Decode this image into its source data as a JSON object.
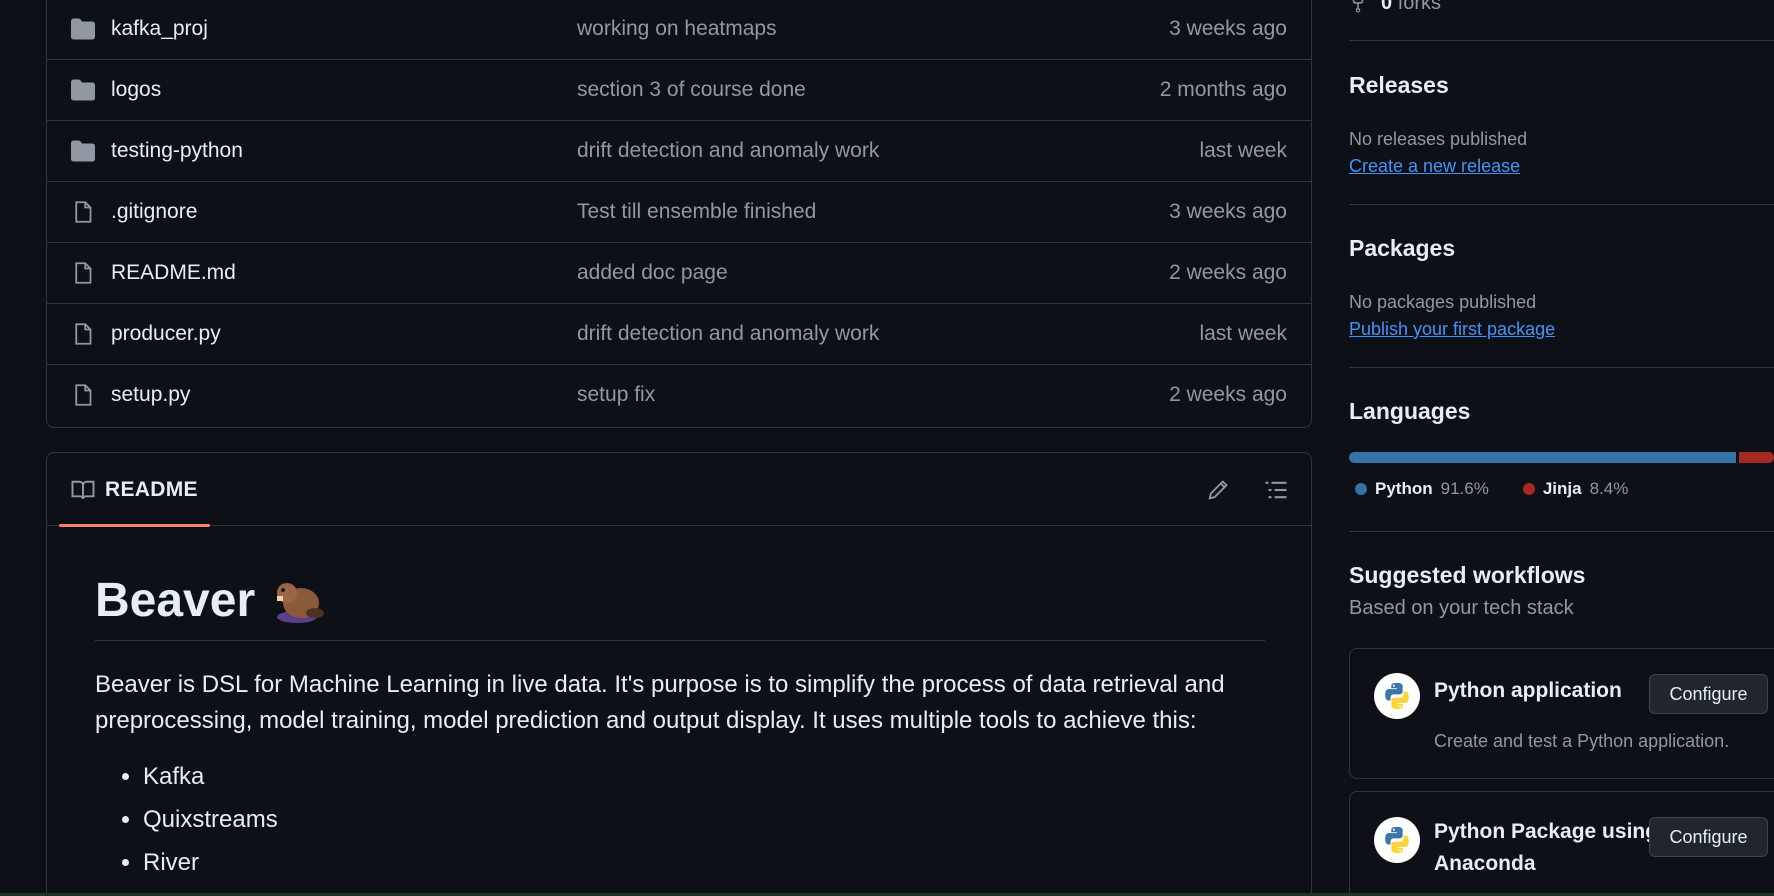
{
  "files": [
    {
      "type": "folder",
      "name": "kafka_proj",
      "message": "working on heatmaps",
      "time": "3 weeks ago"
    },
    {
      "type": "folder",
      "name": "logos",
      "message": "section 3 of course done",
      "time": "2 months ago"
    },
    {
      "type": "folder",
      "name": "testing-python",
      "message": "drift detection and anomaly work",
      "time": "last week"
    },
    {
      "type": "file",
      "name": ".gitignore",
      "message": "Test till ensemble finished",
      "time": "3 weeks ago"
    },
    {
      "type": "file",
      "name": "README.md",
      "message": "added doc page",
      "time": "2 weeks ago"
    },
    {
      "type": "file",
      "name": "producer.py",
      "message": "drift detection and anomaly work",
      "time": "last week"
    },
    {
      "type": "file",
      "name": "setup.py",
      "message": "setup fix",
      "time": "2 weeks ago"
    }
  ],
  "readme": {
    "tab_label": "README",
    "title": "Beaver",
    "title_emoji_icon": "beaver-icon",
    "paragraph": "Beaver is DSL for Machine Learning in live data. It's purpose is to simplify the process of data retrieval and preprocessing, model training, model prediction and output display. It uses multiple tools to achieve this:",
    "list": [
      "Kafka",
      "Quixstreams",
      "River"
    ]
  },
  "sidebar": {
    "forks_count": "0",
    "forks_label": "forks",
    "releases": {
      "heading": "Releases",
      "text": "No releases published",
      "link": "Create a new release"
    },
    "packages": {
      "heading": "Packages",
      "text": "No packages published",
      "link": "Publish your first package"
    },
    "languages": {
      "heading": "Languages",
      "items": [
        {
          "name": "Python",
          "percent": "91.6%",
          "value": 91.6,
          "color": "#3572A5"
        },
        {
          "name": "Jinja",
          "percent": "8.4%",
          "value": 8.4,
          "color": "#a52a22"
        }
      ]
    },
    "workflows": {
      "heading": "Suggested workflows",
      "subheading": "Based on your tech stack",
      "cards": [
        {
          "title": "Python application",
          "description": "Create and test a Python application.",
          "button": "Configure"
        },
        {
          "title": "Python Package using Anaconda",
          "title_line1": "Python Package using",
          "title_line2": "Anaconda",
          "button": "Configure"
        }
      ]
    }
  },
  "colors": {
    "background": "#0d1117",
    "border": "#30363d",
    "link": "#4493f8",
    "tab_underline": "#f78166",
    "muted_text": "#9198a1"
  }
}
